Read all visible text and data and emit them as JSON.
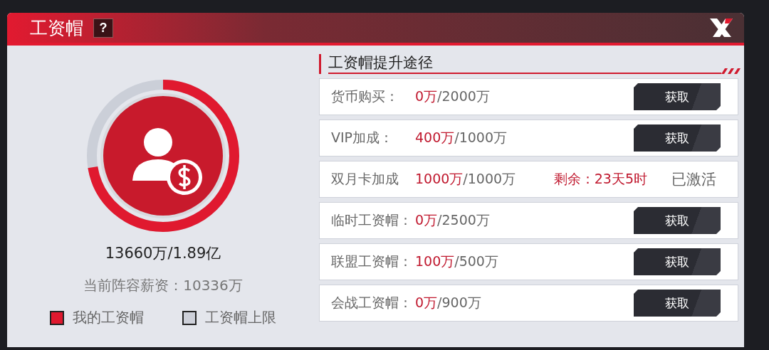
{
  "dialog": {
    "title": "工资帽",
    "help_label": "?"
  },
  "cap": {
    "level": 0.723,
    "reading": "13660万/1.89亿",
    "current_salary": "当前阵容薪资：10336万"
  },
  "legend": [
    {
      "label": "我的工资帽",
      "color": "#e0192f"
    },
    {
      "label": "工资帽上限",
      "color": "#cdd0d9"
    }
  ],
  "routes": {
    "title": "工资帽提升途径",
    "items": [
      {
        "kind": "button",
        "label": "货币购买：",
        "current": "0万",
        "total": "/2000万",
        "action": "获取"
      },
      {
        "kind": "button",
        "label": "VIP加成：",
        "current": "400万",
        "total": "/1000万",
        "action": "获取"
      },
      {
        "kind": "status",
        "label": "双月卡加成",
        "current": "1000万",
        "total": "/1000万",
        "remaining": "剩余：23天5时",
        "status": "已激活"
      },
      {
        "kind": "button",
        "label": "临时工资帽：",
        "current": "0万",
        "total": "/2500万",
        "action": "获取"
      },
      {
        "kind": "button",
        "label": "联盟工资帽：",
        "current": "100万",
        "total": "/500万",
        "action": "获取"
      },
      {
        "kind": "button",
        "label": "会战工资帽：",
        "current": "0万",
        "total": "/900万",
        "action": "获取"
      }
    ]
  }
}
